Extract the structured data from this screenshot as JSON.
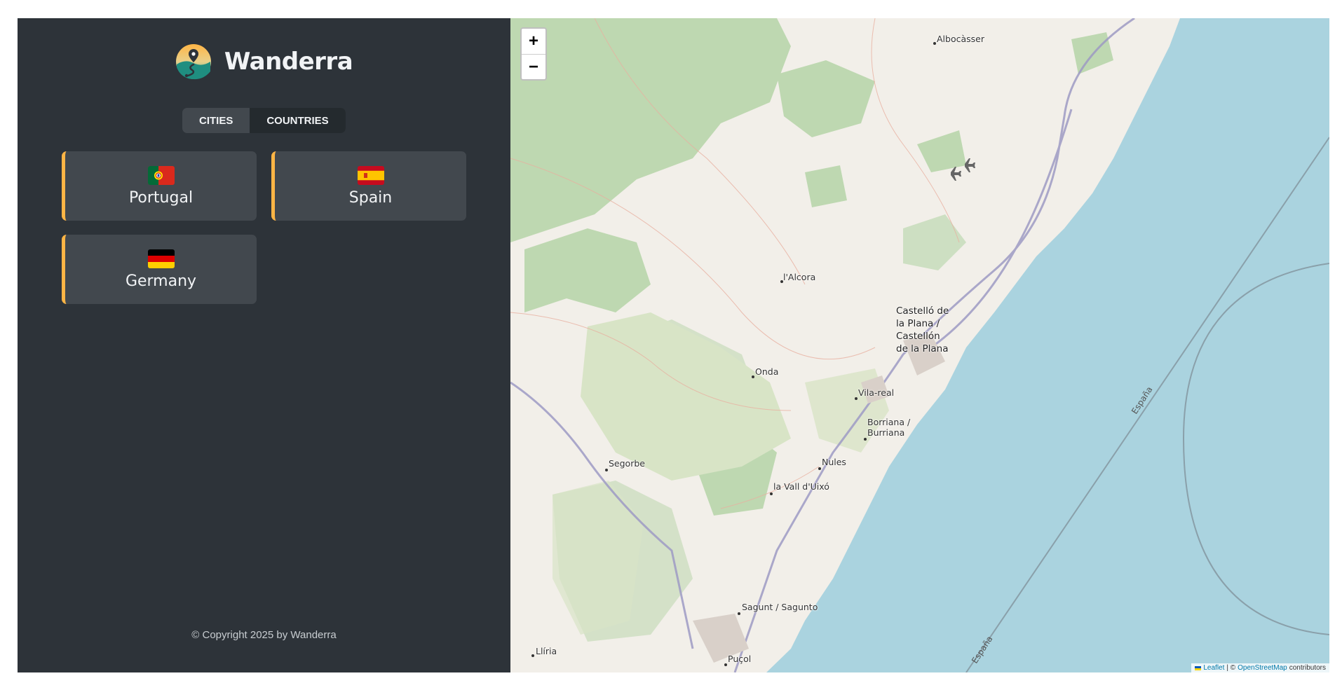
{
  "brand": {
    "name": "Wanderra",
    "logo_icon": "map-pin-logo-icon"
  },
  "tabs": [
    {
      "label": "Cities",
      "active": false
    },
    {
      "label": "Countries",
      "active": true
    }
  ],
  "countries": [
    {
      "name": "Portugal",
      "flag_icon": "portugal-flag-icon"
    },
    {
      "name": "Spain",
      "flag_icon": "spain-flag-icon"
    },
    {
      "name": "Germany",
      "flag_icon": "germany-flag-icon"
    }
  ],
  "footer": {
    "text": "© Copyright 2025 by Wanderra"
  },
  "map": {
    "zoom_in_label": "+",
    "zoom_out_label": "−",
    "attribution": {
      "leaflet": "Leaflet",
      "separator": "| ©",
      "osm": "OpenStreetMap",
      "suffix": "contributors"
    },
    "labels": {
      "albocasser": "Albocàsser",
      "alcora": "l'Alcora",
      "castello_1": "Castelló de",
      "castello_2": "la Plana /",
      "castello_3": "Castellón",
      "castello_4": "de la Plana",
      "onda": "Onda",
      "vila_real": "Vila-real",
      "borriana_1": "Borriana /",
      "borriana_2": "Burriana",
      "segorbe": "Segorbe",
      "nules": "Nules",
      "vall_uixo": "la Vall d'Uixó",
      "sagunt": "Sagunt / Sagunto",
      "lliria": "Llíria",
      "pucol": "Puçol",
      "espana_1": "España",
      "espana_2": "España"
    }
  },
  "colors": {
    "sidebar_bg": "#2d3339",
    "card_bg": "#42484e",
    "accent": "#ffb545",
    "sea": "#aad3df",
    "land": "#f2efe9"
  }
}
